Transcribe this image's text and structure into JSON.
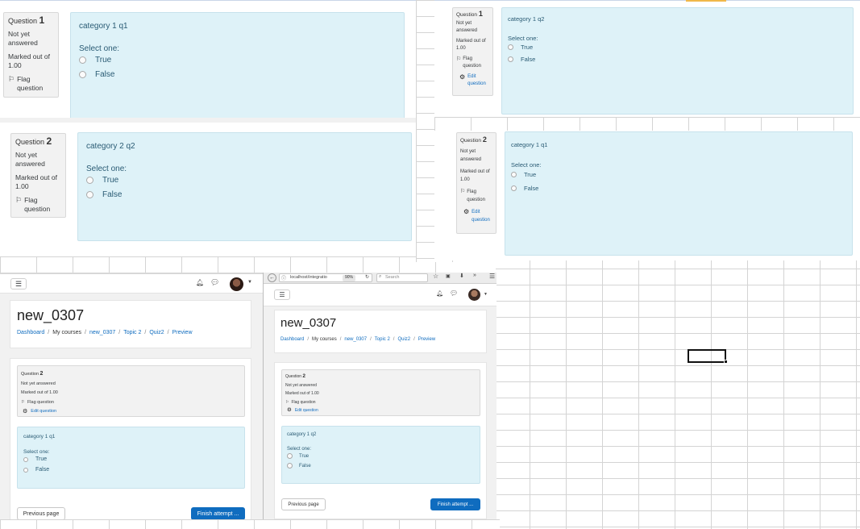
{
  "common": {
    "question_word": "Question",
    "not_answered": "Not yet answered",
    "marked": "Marked out of 1.00",
    "flag": "Flag question",
    "edit": "Edit question",
    "select_one": "Select one:",
    "opt_true": "True",
    "opt_false": "False"
  },
  "panel_a": {
    "q1": {
      "number": "1",
      "title": "category 1 q1"
    },
    "q2": {
      "number": "2",
      "title": "category 2 q2"
    }
  },
  "panel_b": {
    "q1": {
      "number": "1",
      "title": "category 1 q2"
    },
    "q2": {
      "number": "2",
      "title": "category 1 q1"
    }
  },
  "panel_c": {
    "page_title": "new_0307",
    "breadcrumb": [
      "Dashboard",
      "My courses",
      "new_0307",
      "Topic 2",
      "Quiz2",
      "Preview"
    ],
    "question": {
      "number": "2",
      "title": "category 1 q1"
    },
    "prev_button": "Previous page",
    "finish_button": "Finish attempt ..."
  },
  "panel_d": {
    "url": "localhost/integratio",
    "zoom": "90%",
    "search_placeholder": "Search",
    "page_title": "new_0307",
    "breadcrumb": [
      "Dashboard",
      "My courses",
      "new_0307",
      "Topic 2",
      "Quiz2",
      "Preview"
    ],
    "question": {
      "number": "2",
      "title": "category 1 q2"
    },
    "prev_button": "Previous page",
    "finish_button": "Finish attempt ..."
  },
  "colors": {
    "link": "#0f6cbf",
    "content_bg": "#def2f8",
    "info_bg": "#f2f2f2",
    "primary_button": "#0f6cbf"
  }
}
